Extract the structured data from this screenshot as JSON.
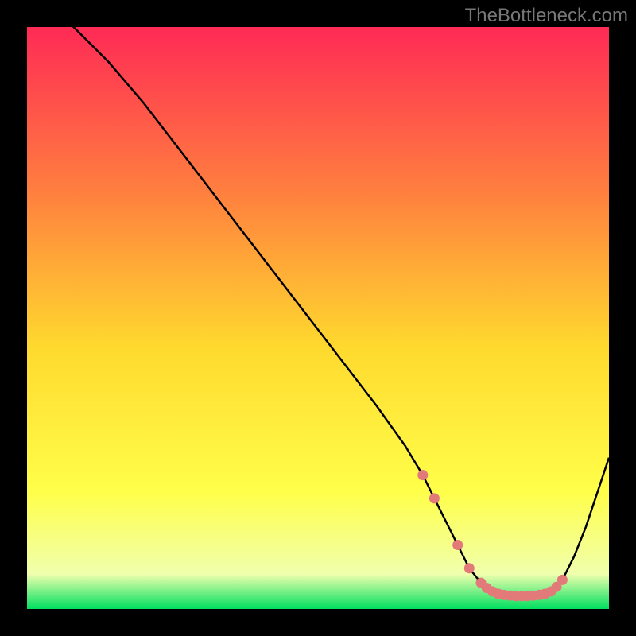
{
  "watermark": "TheBottleneck.com",
  "chart_data": {
    "type": "line",
    "title": "",
    "xlabel": "",
    "ylabel": "",
    "xlim": [
      0,
      100
    ],
    "ylim": [
      0,
      100
    ],
    "background_gradient": {
      "top": "#ff2a55",
      "mid_upper": "#ff7e3f",
      "mid": "#ffd92e",
      "mid_lower": "#ffff4a",
      "near_bottom": "#f0ffad",
      "bottom": "#00e060"
    },
    "series": [
      {
        "name": "bottleneck-curve",
        "type": "line",
        "x": [
          0,
          8,
          14,
          20,
          30,
          40,
          50,
          60,
          65,
          68,
          70,
          72,
          74,
          76,
          78,
          80,
          82,
          84,
          86,
          88,
          90,
          92,
          94,
          96,
          98,
          100
        ],
        "y": [
          105,
          100,
          94,
          87,
          74,
          61,
          48,
          35,
          28,
          23,
          19,
          15,
          11,
          7,
          4.5,
          3,
          2.4,
          2.2,
          2.2,
          2.4,
          3,
          5,
          9,
          14,
          20,
          26
        ]
      },
      {
        "name": "curve-markers",
        "type": "scatter",
        "color": "#e27a7a",
        "x": [
          68,
          70,
          74,
          76,
          78,
          79,
          80,
          81,
          82,
          83,
          84,
          85,
          86,
          87,
          88,
          89,
          90,
          91,
          92
        ],
        "y": [
          23,
          19,
          11,
          7,
          4.5,
          3.6,
          3,
          2.6,
          2.4,
          2.3,
          2.2,
          2.2,
          2.2,
          2.3,
          2.4,
          2.6,
          3,
          3.8,
          5
        ]
      }
    ]
  }
}
